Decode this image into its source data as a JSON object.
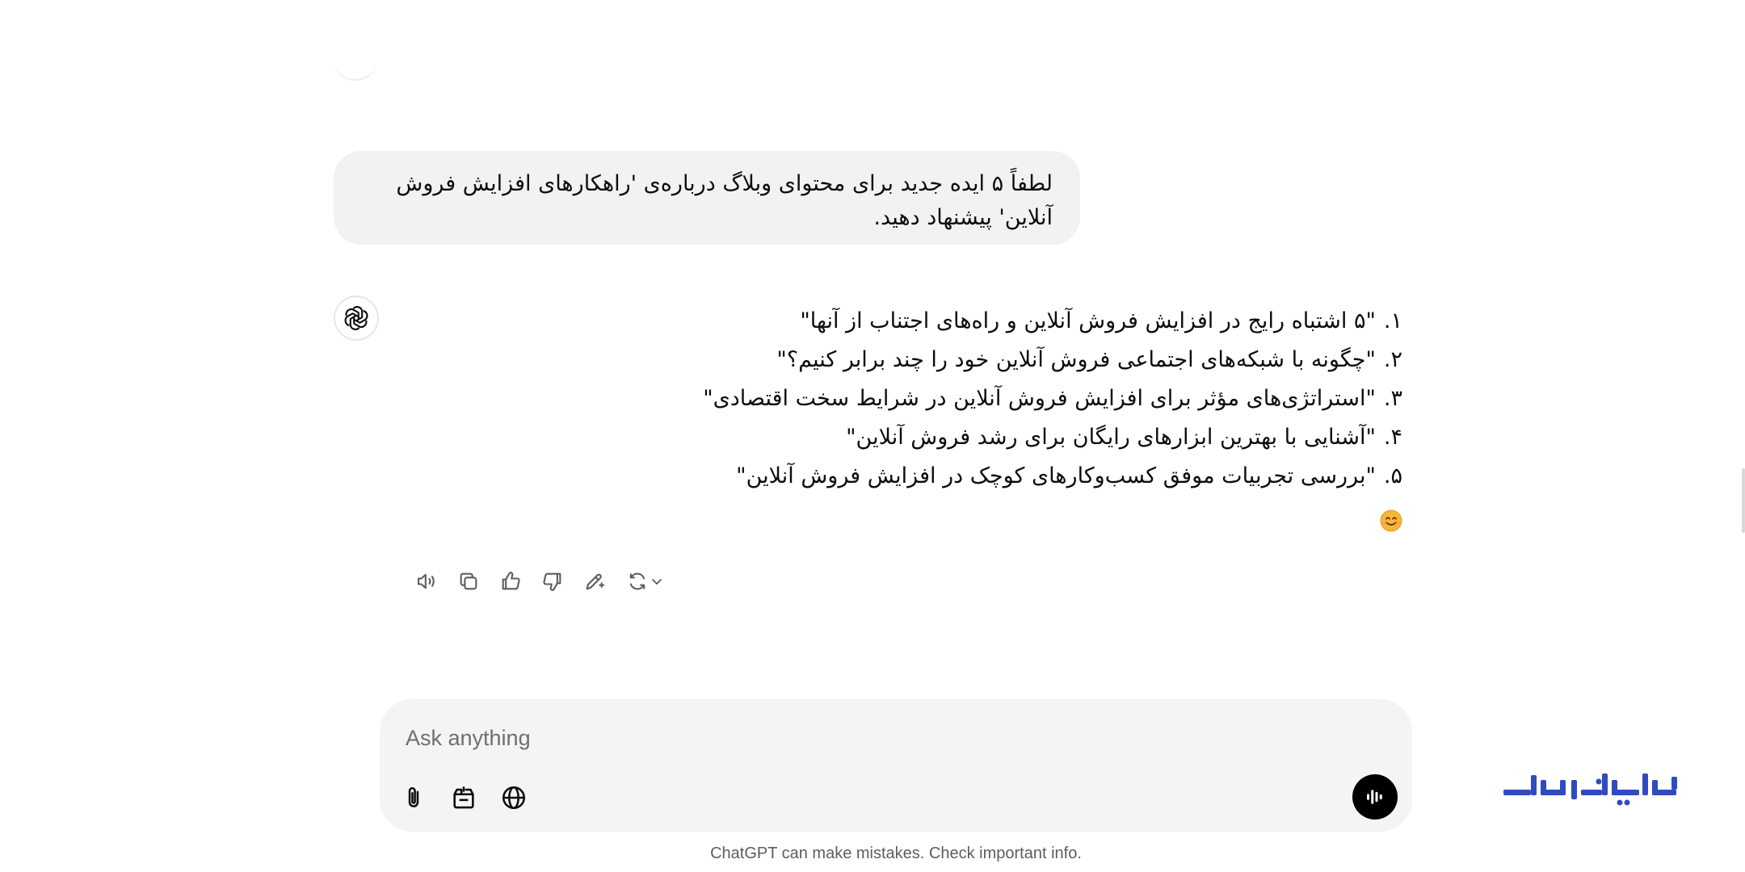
{
  "user_message": {
    "text": "لطفاً ۵ ایده جدید برای محتوای وبلاگ درباره‌ی 'راهکارهای افزایش فروش آنلاین' پیشنهاد دهید."
  },
  "assistant_message": {
    "items": [
      {
        "num": "۱.",
        "text": "\"۵ اشتباه رایج در افزایش فروش آنلاین و راه‌های اجتناب از آنها\""
      },
      {
        "num": "۲.",
        "text": "\"چگونه با شبکه‌های اجتماعی فروش آنلاین خود را چند برابر کنیم؟\""
      },
      {
        "num": "۳.",
        "text": "\"استراتژی‌های مؤثر برای افزایش فروش آنلاین در شرایط سخت اقتصادی\""
      },
      {
        "num": "۴.",
        "text": "\"آشنایی با بهترین ابزارهای رایگان برای رشد فروش آنلاین\""
      },
      {
        "num": "۵.",
        "text": "\"بررسی تجربیات موفق کسب‌وکارهای کوچک در افزایش فروش آنلاین\""
      }
    ],
    "emoji": "smiling-face"
  },
  "message_actions": [
    {
      "name": "read-aloud-button",
      "icon": "speaker-icon"
    },
    {
      "name": "copy-button",
      "icon": "copy-icon"
    },
    {
      "name": "good-response-button",
      "icon": "thumbs-up-icon"
    },
    {
      "name": "bad-response-button",
      "icon": "thumbs-down-icon"
    },
    {
      "name": "edit-canvas-button",
      "icon": "pencil-sparkle-icon"
    },
    {
      "name": "regenerate-button",
      "icon": "refresh-icon"
    }
  ],
  "composer": {
    "placeholder": "Ask anything",
    "tools": [
      {
        "name": "attach-button",
        "icon": "paperclip-icon"
      },
      {
        "name": "tools-button",
        "icon": "toolbox-icon"
      },
      {
        "name": "search-web-button",
        "icon": "globe-icon"
      }
    ],
    "voice_icon": "voice-waveform-icon"
  },
  "disclaimer": "ChatGPT can make mistakes. Check important info.",
  "watermark": {
    "text": "ایران سرور",
    "color": "#2f4bbf"
  },
  "colors": {
    "bubble": "#f2f2f2",
    "composer": "#f4f4f4",
    "text": "#0d0d0d",
    "muted": "#5d5d5d"
  }
}
